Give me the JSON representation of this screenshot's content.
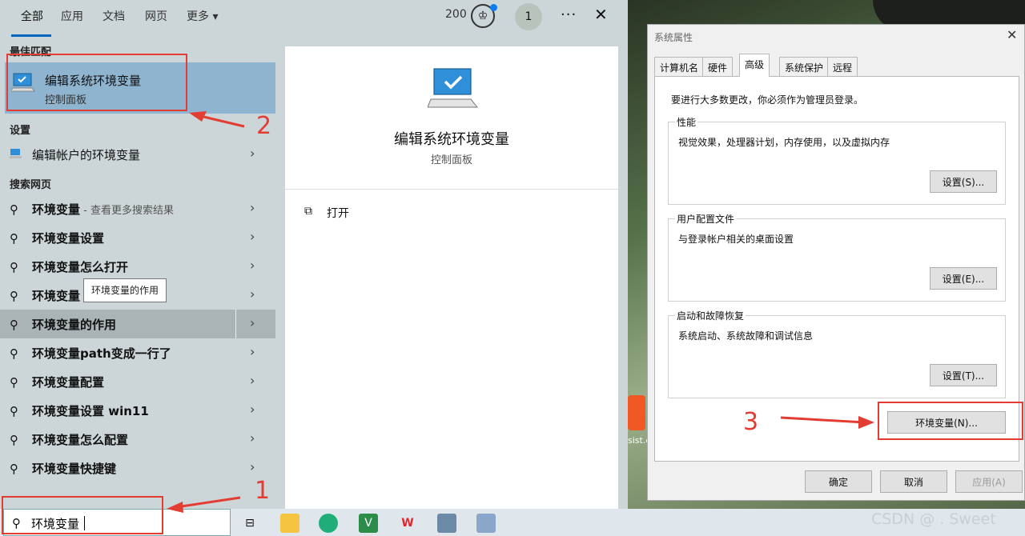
{
  "search": {
    "tabs": [
      "全部",
      "应用",
      "文档",
      "网页",
      "更多"
    ],
    "points": "200",
    "avatar": "1",
    "more_icon": "ellipsis-icon",
    "close_icon": "close-icon",
    "best_match_header": "最佳匹配",
    "best_match": {
      "title": "编辑系统环境变量",
      "subtitle": "控制面板"
    },
    "settings_header": "设置",
    "settings_item": "编辑帐户的环境变量",
    "web_header": "搜索网页",
    "web_items": [
      {
        "bold": "环境变量",
        "extra": " - 查看更多搜索结果"
      },
      {
        "bold": "环境变量设置",
        "extra": ""
      },
      {
        "bold": "环境变量怎么打开",
        "extra": ""
      },
      {
        "bold": "环境变量",
        "extra": ""
      },
      {
        "bold": "环境变量的作用",
        "extra": ""
      },
      {
        "bold": "环境变量path变成一行了",
        "extra": ""
      },
      {
        "bold": "环境变量配置",
        "extra": ""
      },
      {
        "bold": "环境变量设置 win11",
        "extra": ""
      },
      {
        "bold": "环境变量怎么配置",
        "extra": ""
      },
      {
        "bold": "环境变量快捷键",
        "extra": ""
      }
    ],
    "tooltip": "环境变量的作用",
    "preview": {
      "title": "编辑系统环境变量",
      "subtitle": "控制面板",
      "open_label": "打开"
    },
    "query": "环境变量"
  },
  "dialog": {
    "title": "系统属性",
    "tabs": [
      "计算机名",
      "硬件",
      "高级",
      "系统保护",
      "远程"
    ],
    "active_tab": "高级",
    "note": "要进行大多数更改，你必须作为管理员登录。",
    "groups": [
      {
        "label": "性能",
        "desc": "视觉效果，处理器计划，内存使用，以及虚拟内存",
        "button": "设置(S)..."
      },
      {
        "label": "用户配置文件",
        "desc": "与登录帐户相关的桌面设置",
        "button": "设置(E)..."
      },
      {
        "label": "启动和故障恢复",
        "desc": "系统启动、系统故障和调试信息",
        "button": "设置(T)..."
      }
    ],
    "env_button": "环境变量(N)...",
    "ok": "确定",
    "cancel": "取消",
    "apply": "应用(A)"
  },
  "annotations": [
    "1",
    "2",
    "3"
  ],
  "watermark": "CSDN @ . Sweet",
  "desktop_label": "sist.e",
  "colors": {
    "accent": "#0067c0",
    "annotation": "#e33d33",
    "highlight": "#8eb4cf"
  }
}
